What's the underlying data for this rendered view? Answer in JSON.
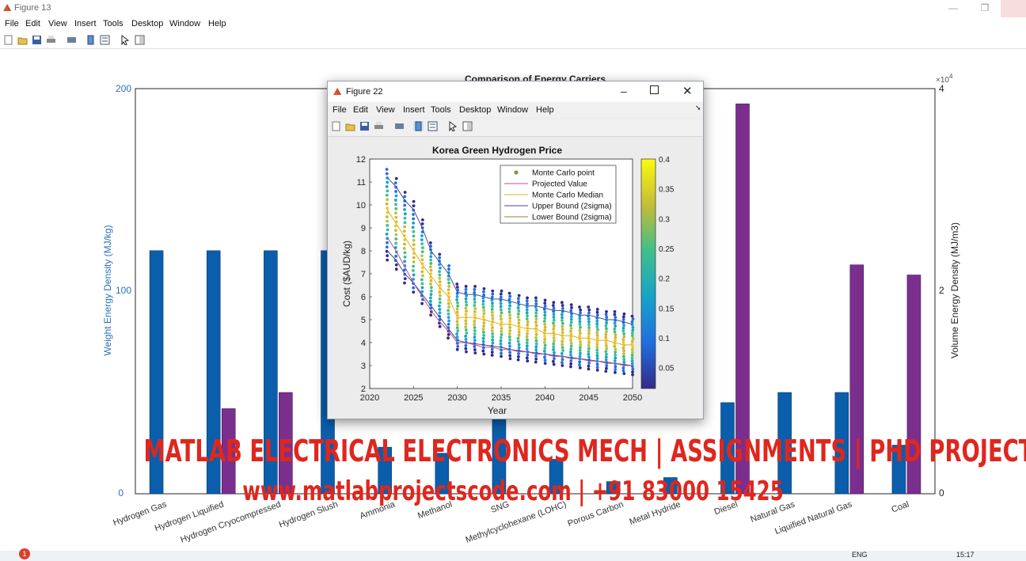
{
  "window": {
    "title": "Figure 13",
    "menu": [
      "File",
      "Edit",
      "View",
      "Insert",
      "Tools",
      "Desktop",
      "Window",
      "Help"
    ]
  },
  "main_chart": {
    "title": "Comparison of Energy Carriers",
    "ylabel_left": "Weight Energy Density (MJ/kg)",
    "ylabel_right": "Volume Energy Density (MJ/m3)",
    "left_ticks": [
      "0",
      "100",
      "200"
    ],
    "right_ticks": [
      "0",
      "2",
      "4"
    ],
    "right_exponent": "×10",
    "right_exponent_power": "4",
    "categories": [
      "Hydrogen Gas",
      "Hydrogen Liquified",
      "Hydrogen Cryocompressed",
      "Hydrogen Slush",
      "Ammonia",
      "Methanol",
      "SNG",
      "Methylcyclohexane (LOHC)",
      "Porous Carbon",
      "Metal Hydride",
      "Diesel",
      "Natural Gas",
      "Liquified Natural Gas",
      "Coal"
    ],
    "colors": {
      "weight": "#0a5eab",
      "volume": "#7a2f8e",
      "left_axis": "#2a6fbd"
    }
  },
  "chart_data": [
    {
      "type": "bar",
      "title": "Comparison of Energy Carriers",
      "xlabel": "",
      "ylabel": "Weight Energy Density (MJ/kg)",
      "y2label": "Volume Energy Density (MJ/m3)",
      "categories": [
        "Hydrogen Gas",
        "Hydrogen Liquified",
        "Hydrogen Cryocompressed",
        "Hydrogen Slush",
        "Ammonia",
        "Methanol",
        "SNG",
        "Methylcyclohexane (LOHC)",
        "Porous Carbon",
        "Metal Hydride",
        "Diesel",
        "Natural Gas",
        "Liquified Natural Gas",
        "Coal"
      ],
      "series": [
        {
          "name": "Weight",
          "axis": "left",
          "values": [
            120,
            120,
            120,
            120,
            23,
            20,
            55,
            17,
            6,
            8,
            45,
            50,
            50,
            24
          ]
        },
        {
          "name": "Volume",
          "axis": "right",
          "values": [
            null,
            8400,
            10000,
            null,
            null,
            null,
            null,
            null,
            null,
            null,
            38500,
            null,
            22600,
            21600
          ]
        }
      ],
      "ylim": [
        0,
        200
      ],
      "y2lim": [
        0,
        40000
      ]
    },
    {
      "type": "scatter",
      "title": "Korea Green Hydrogen Price",
      "xlabel": "Year",
      "ylabel": "Cost ($AUD/kg)",
      "xlim": [
        2020,
        2050
      ],
      "ylim": [
        2,
        12
      ],
      "legend": [
        "Monte Carlo point",
        "Projected Value",
        "Monte Carlo Median",
        "Upper Bound (2sigma)",
        "Lower Bound (2sigma)"
      ],
      "legend_position": "top-right",
      "colorbar": [
        0.05,
        0.1,
        0.15,
        0.2,
        0.25,
        0.3,
        0.35,
        0.4
      ],
      "x": [
        2022,
        2023,
        2024,
        2025,
        2026,
        2027,
        2028,
        2029,
        2030,
        2031,
        2032,
        2033,
        2034,
        2035,
        2036,
        2037,
        2038,
        2039,
        2040,
        2041,
        2042,
        2043,
        2044,
        2045,
        2046,
        2047,
        2048,
        2049,
        2050
      ],
      "series": [
        {
          "name": "Monte Carlo Median",
          "values": [
            9.8,
            9.2,
            8.6,
            8.0,
            7.4,
            6.9,
            6.4,
            6.0,
            5.1,
            5.1,
            5.1,
            5.0,
            4.9,
            4.8,
            4.8,
            4.7,
            4.6,
            4.6,
            4.4,
            4.4,
            4.3,
            4.3,
            4.2,
            4.2,
            4.1,
            4.1,
            4.0,
            3.9,
            3.9
          ]
        },
        {
          "name": "Upper Bound (2sigma)",
          "values": [
            11.2,
            10.8,
            10.2,
            9.8,
            9.0,
            8.0,
            7.5,
            7.0,
            6.2,
            6.1,
            6.1,
            6.0,
            5.9,
            5.9,
            5.8,
            5.7,
            5.6,
            5.6,
            5.5,
            5.4,
            5.4,
            5.3,
            5.2,
            5.2,
            5.1,
            5.0,
            5.0,
            4.9,
            4.8
          ]
        },
        {
          "name": "Lower Bound (2sigma)",
          "values": [
            8.0,
            7.6,
            7.0,
            6.6,
            6.1,
            5.6,
            5.1,
            4.6,
            4.1,
            4.0,
            3.95,
            3.9,
            3.85,
            3.8,
            3.7,
            3.65,
            3.6,
            3.55,
            3.5,
            3.45,
            3.4,
            3.35,
            3.3,
            3.25,
            3.2,
            3.15,
            3.1,
            3.05,
            3.0
          ]
        },
        {
          "name": "Projected Value",
          "values": [
            8.6,
            8.0,
            7.3,
            6.6,
            6.0,
            5.4,
            4.9,
            4.5,
            4.0,
            4.0,
            3.9,
            3.8,
            3.8,
            3.7,
            3.7,
            3.6,
            3.6,
            3.5,
            3.5,
            3.4,
            3.4,
            3.3,
            3.3,
            3.2,
            3.2,
            3.1,
            3.1,
            3.0,
            3.0
          ]
        }
      ]
    }
  ],
  "popup": {
    "title": "Figure 22",
    "menu": [
      "File",
      "Edit",
      "View",
      "Insert",
      "Tools",
      "Desktop",
      "Window",
      "Help"
    ],
    "chart_title": "Korea Green Hydrogen Price",
    "xlabel": "Year",
    "ylabel": "Cost ($AUD/kg)",
    "xticks": [
      "2020",
      "2025",
      "2030",
      "2035",
      "2040",
      "2045",
      "2050"
    ],
    "yticks": [
      "2",
      "3",
      "4",
      "5",
      "6",
      "7",
      "8",
      "9",
      "10",
      "11",
      "12"
    ],
    "colorbar_ticks": [
      "0.05",
      "0.1",
      "0.15",
      "0.2",
      "0.25",
      "0.3",
      "0.35",
      "0.4"
    ],
    "legend": [
      "Monte Carlo point",
      "Projected Value",
      "Monte Carlo Median",
      "Upper Bound (2sigma)",
      "Lower Bound (2sigma)"
    ],
    "legend_colors": [
      "#7a9a3c",
      "#c0508f",
      "#e0b020",
      "#4a4aa0",
      "#a0783c"
    ]
  },
  "watermark": {
    "line1": "MATLAB ELECTRICAL ELECTRONICS MECH | ASSIGNMENTS | PHD PROJECTS",
    "line2": "www.matlabprojectscode.com | +91 83000 15425"
  },
  "taskbar": {
    "lang": "ENG",
    "time": "15:17",
    "badge": "1"
  }
}
